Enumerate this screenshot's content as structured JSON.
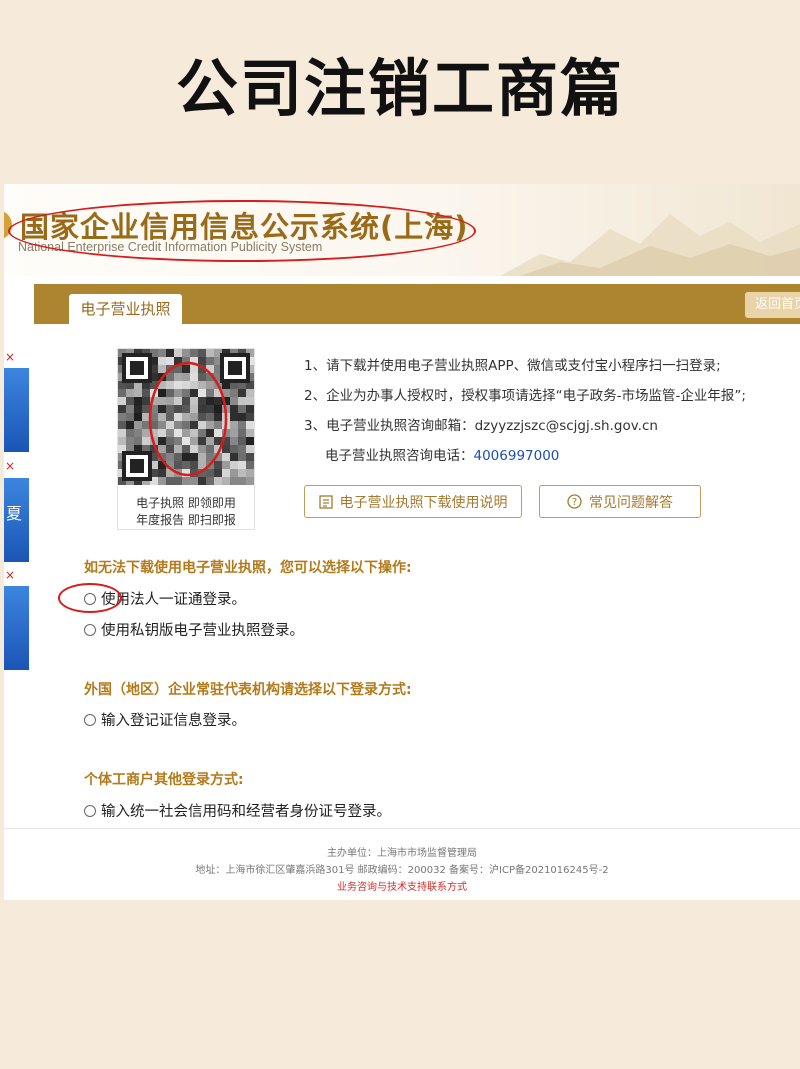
{
  "post_title": "公司注销工商篇",
  "site": {
    "title": "国家企业信用信息公示系统(上海)",
    "subtitle": "National Enterprise Credit Information Publicity System"
  },
  "card": {
    "tab_label": "电子营业执照",
    "back_label": "返回首页"
  },
  "qr": {
    "caption_line1": "电子执照 即领即用",
    "caption_line2": "年度报告 即扫即报"
  },
  "info": {
    "line1": "1、请下载并使用电子营业执照APP、微信或支付宝小程序扫一扫登录;",
    "line2": "2、企业为办事人授权时，授权事项请选择“电子政务-市场监管-企业年报”;",
    "line3": "3、电子营业执照咨询邮箱：dzyyzzjszc@scjgj.sh.gov.cn",
    "phone_label": "电子营业执照咨询电话：",
    "phone": "4006997000"
  },
  "buttons": {
    "manual": "电子营业执照下载使用说明",
    "faq": "常见问题解答"
  },
  "sections": [
    {
      "title": "如无法下载使用电子营业执照，您可以选择以下操作:",
      "options": [
        "使用法人一证通登录。",
        "使用私钥版电子营业执照登录。"
      ]
    },
    {
      "title": "外国（地区）企业常驻代表机构请选择以下登录方式:",
      "options": [
        "输入登记证信息登录。"
      ]
    },
    {
      "title": "个体工商户其他登录方式:",
      "options": [
        "输入统一社会信用码和经营者身份证号登录。"
      ]
    }
  ],
  "footer": {
    "organizer": "主办单位：上海市市场监督管理局",
    "address": "地址：上海市徐汇区肇嘉浜路301号 邮政编码：200032 备案号：沪ICP备2021016245号-2",
    "contact_link": "业务咨询与技术支持联系方式"
  },
  "side_ads": {
    "close_symbol": "×",
    "glyph": "夏"
  },
  "colors": {
    "brand_gold": "#ad8531",
    "annotation_red": "#d61c1c",
    "page_bg": "#f6ebdb"
  }
}
